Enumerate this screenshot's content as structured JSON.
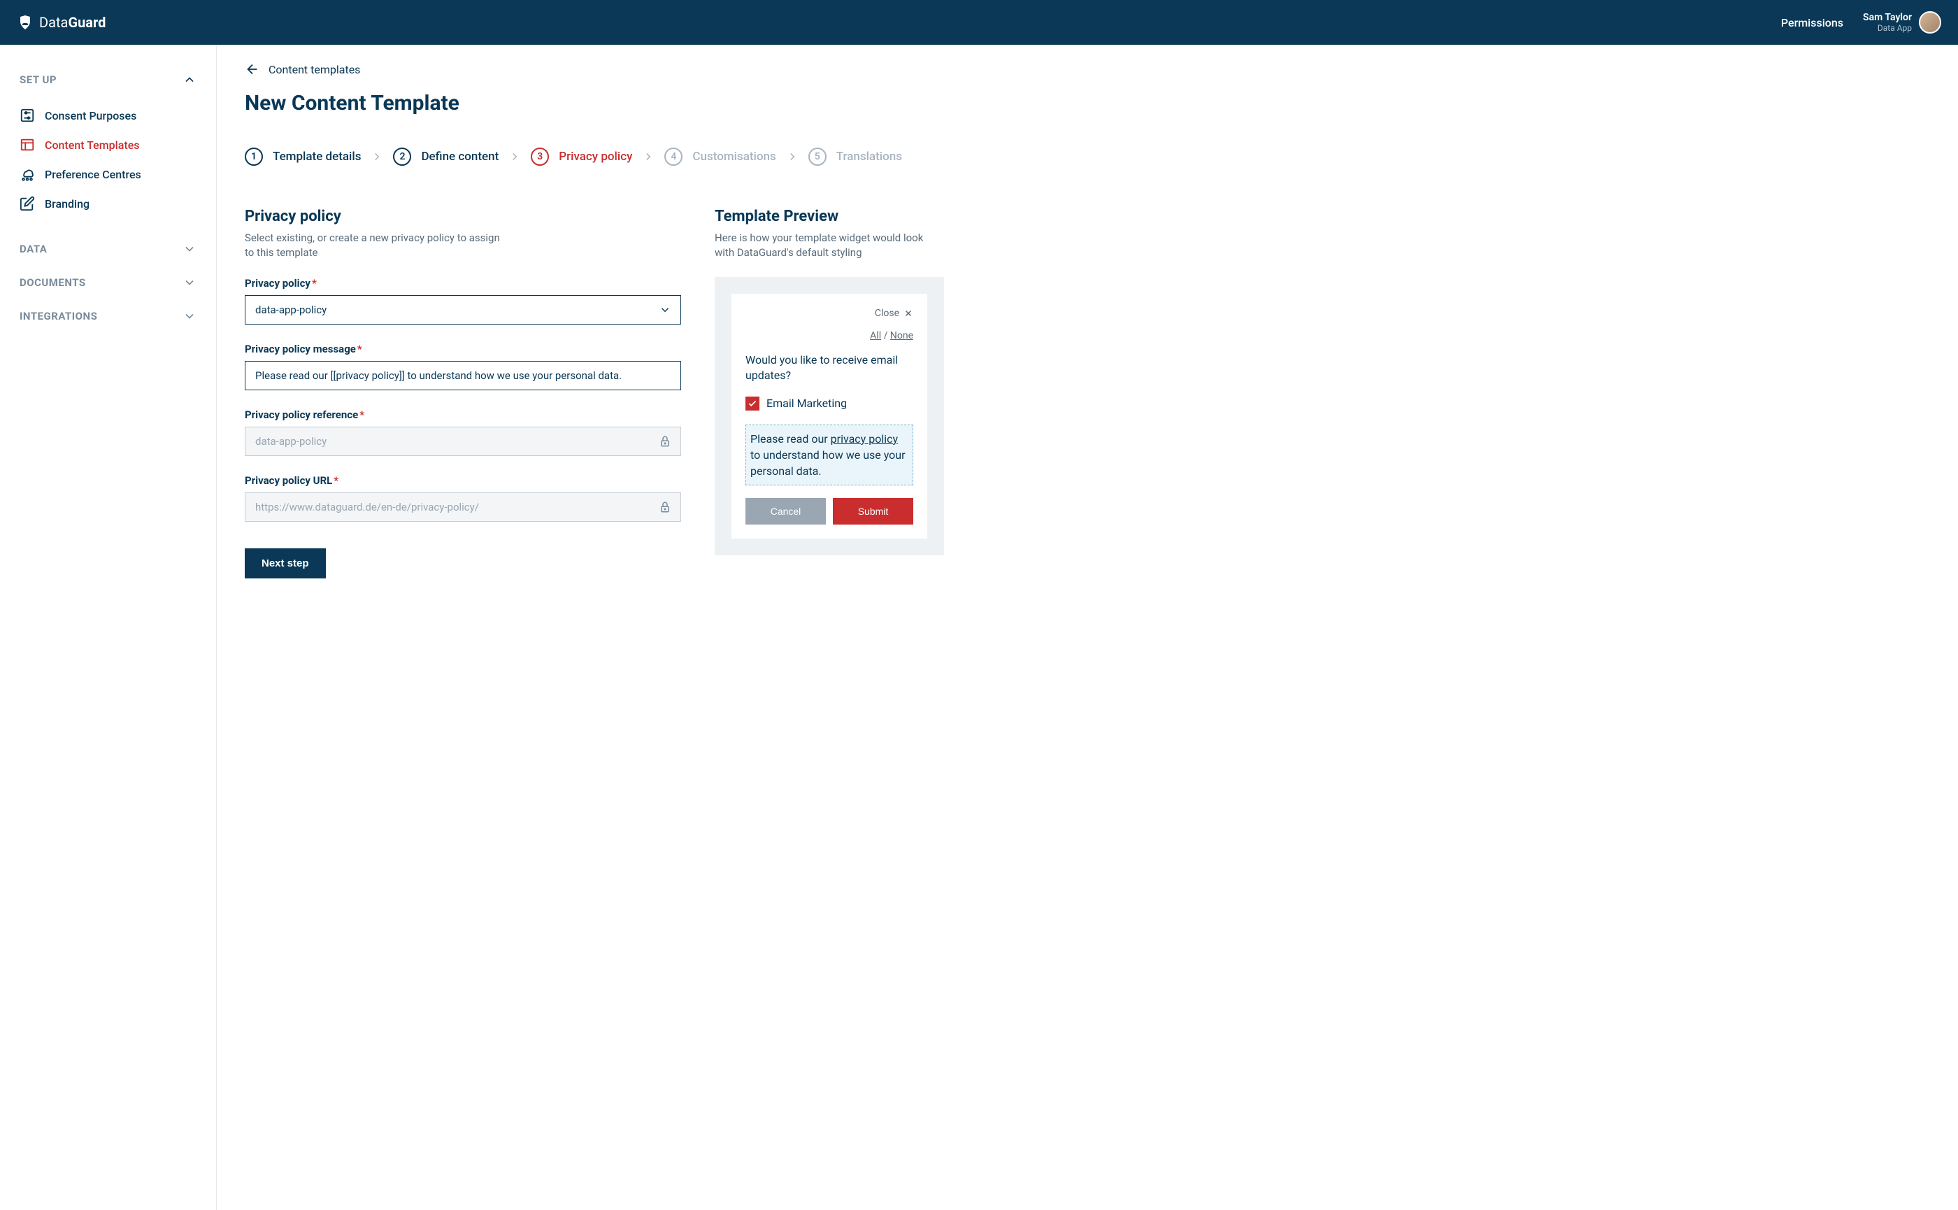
{
  "header": {
    "brand_prefix": "Data",
    "brand_bold": "Guard",
    "permissions_label": "Permissions",
    "user_name": "Sam Taylor",
    "user_app": "Data App"
  },
  "sidebar": {
    "sections": {
      "setup": {
        "title": "SET UP"
      },
      "data": {
        "title": "DATA"
      },
      "documents": {
        "title": "DOCUMENTS"
      },
      "integrations": {
        "title": "INTEGRATIONS"
      }
    },
    "items": [
      {
        "label": "Consent Purposes"
      },
      {
        "label": "Content Templates"
      },
      {
        "label": "Preference Centres"
      },
      {
        "label": "Branding"
      }
    ]
  },
  "breadcrumb": {
    "label": "Content templates"
  },
  "page_title": "New Content Template",
  "stepper": [
    {
      "num": "1",
      "label": "Template details"
    },
    {
      "num": "2",
      "label": "Define content"
    },
    {
      "num": "3",
      "label": "Privacy policy"
    },
    {
      "num": "4",
      "label": "Customisations"
    },
    {
      "num": "5",
      "label": "Translations"
    }
  ],
  "form": {
    "section_title": "Privacy policy",
    "section_desc": "Select existing, or create a new privacy policy to assign to this template",
    "fields": {
      "policy": {
        "label": "Privacy policy",
        "value": "data-app-policy"
      },
      "message": {
        "label": "Privacy policy message",
        "value": "Please read our [[privacy policy]] to understand how we use your personal data."
      },
      "reference": {
        "label": "Privacy policy reference",
        "value": "data-app-policy"
      },
      "url": {
        "label": "Privacy policy URL",
        "value": "https://www.dataguard.de/en-de/privacy-policy/"
      }
    },
    "next_button": "Next step"
  },
  "preview": {
    "title": "Template Preview",
    "desc": "Here is how your template widget would look with DataGuard's default styling",
    "close": "Close",
    "all": "All",
    "separator": " / ",
    "none": "None",
    "question": "Would you like to receive email updates?",
    "checkbox_label": "Email Marketing",
    "policy_text_1": "Please read our ",
    "policy_link": "privacy policy",
    "policy_text_2": " to understand how we use your personal data.",
    "cancel": "Cancel",
    "submit": "Submit"
  }
}
